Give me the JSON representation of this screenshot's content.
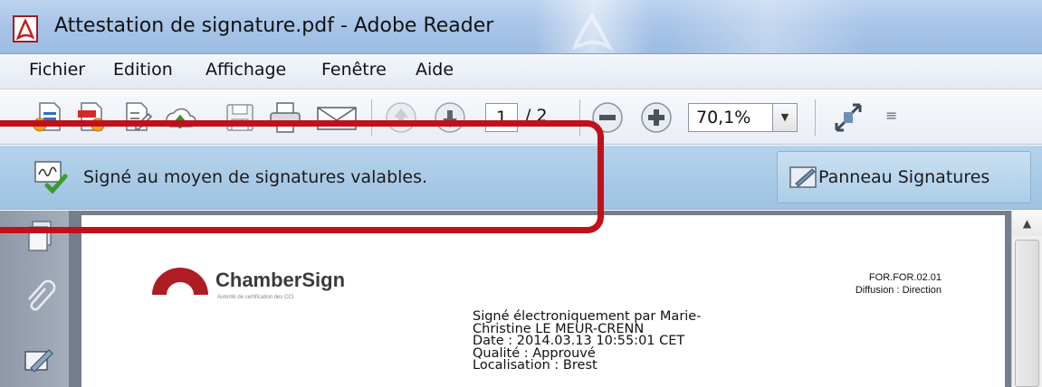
{
  "window": {
    "title": "Attestation de signature.pdf - Adobe Reader",
    "app_icon": "adobe-reader-icon"
  },
  "menu": {
    "items": [
      "Fichier",
      "Edition",
      "Affichage",
      "Fenêtre",
      "Aide"
    ]
  },
  "toolbar": {
    "icons": [
      "create-pdf-icon",
      "share-pdf-icon",
      "edit-pdf-icon",
      "upload-cloud-icon",
      "save-icon",
      "print-icon",
      "email-icon",
      "previous-page-icon",
      "next-page-icon",
      "zoom-out-icon",
      "zoom-in-icon",
      "fit-window-icon"
    ],
    "current_page": "1",
    "total_pages": "/ 2",
    "zoom": "70,1%"
  },
  "signature_bar": {
    "message": "Signé au moyen de signatures valables.",
    "panel_button": "Panneau Signatures"
  },
  "navigation_pane": {
    "icons": [
      "pages-icon",
      "attachment-icon",
      "signature-icon"
    ]
  },
  "document": {
    "logo": "ChamberSign",
    "logo_tagline": "Autorité de certification des CCI",
    "reference": "FOR.FOR.02.01",
    "diffusion": "Diffusion : Direction",
    "signature_lines": [
      "Signé électroniquement par Marie-",
      "Christine LE MEUR-CRENN",
      "Date : 2014.03.13 10:55:01 CET",
      "Qualité : Approuvé",
      "Localisation : Brest"
    ]
  },
  "colors": {
    "highlight": "#c0111a",
    "signature_bar": "#a9cae6",
    "logo_red": "#b01c24"
  }
}
